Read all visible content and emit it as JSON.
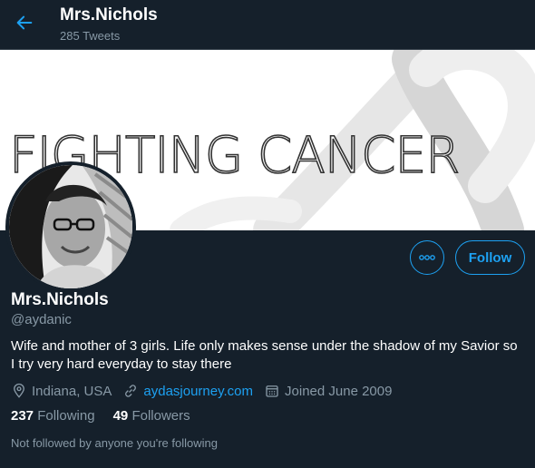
{
  "colors": {
    "background": "#15202b",
    "accent": "#1da1f2",
    "muted": "#8899a6"
  },
  "header": {
    "back_icon": "arrow-left-icon",
    "title": "Mrs.Nichols",
    "tweet_count": "285 Tweets"
  },
  "banner": {
    "text": "FIGHTING CANCER"
  },
  "actions": {
    "more_icon": "more-dots-icon",
    "follow_label": "Follow"
  },
  "profile": {
    "name": "Mrs.Nichols",
    "handle": "@aydanic",
    "bio": "Wife and mother of 3 girls. Life only makes sense under the shadow of my Savior so I try very hard everyday to stay there",
    "location": "Indiana, USA",
    "website": "aydasjourney.com",
    "joined": "Joined June 2009",
    "following_count": "237",
    "following_label": "Following",
    "followers_count": "49",
    "followers_label": "Followers",
    "followed_by_note": "Not followed by anyone you're following"
  }
}
